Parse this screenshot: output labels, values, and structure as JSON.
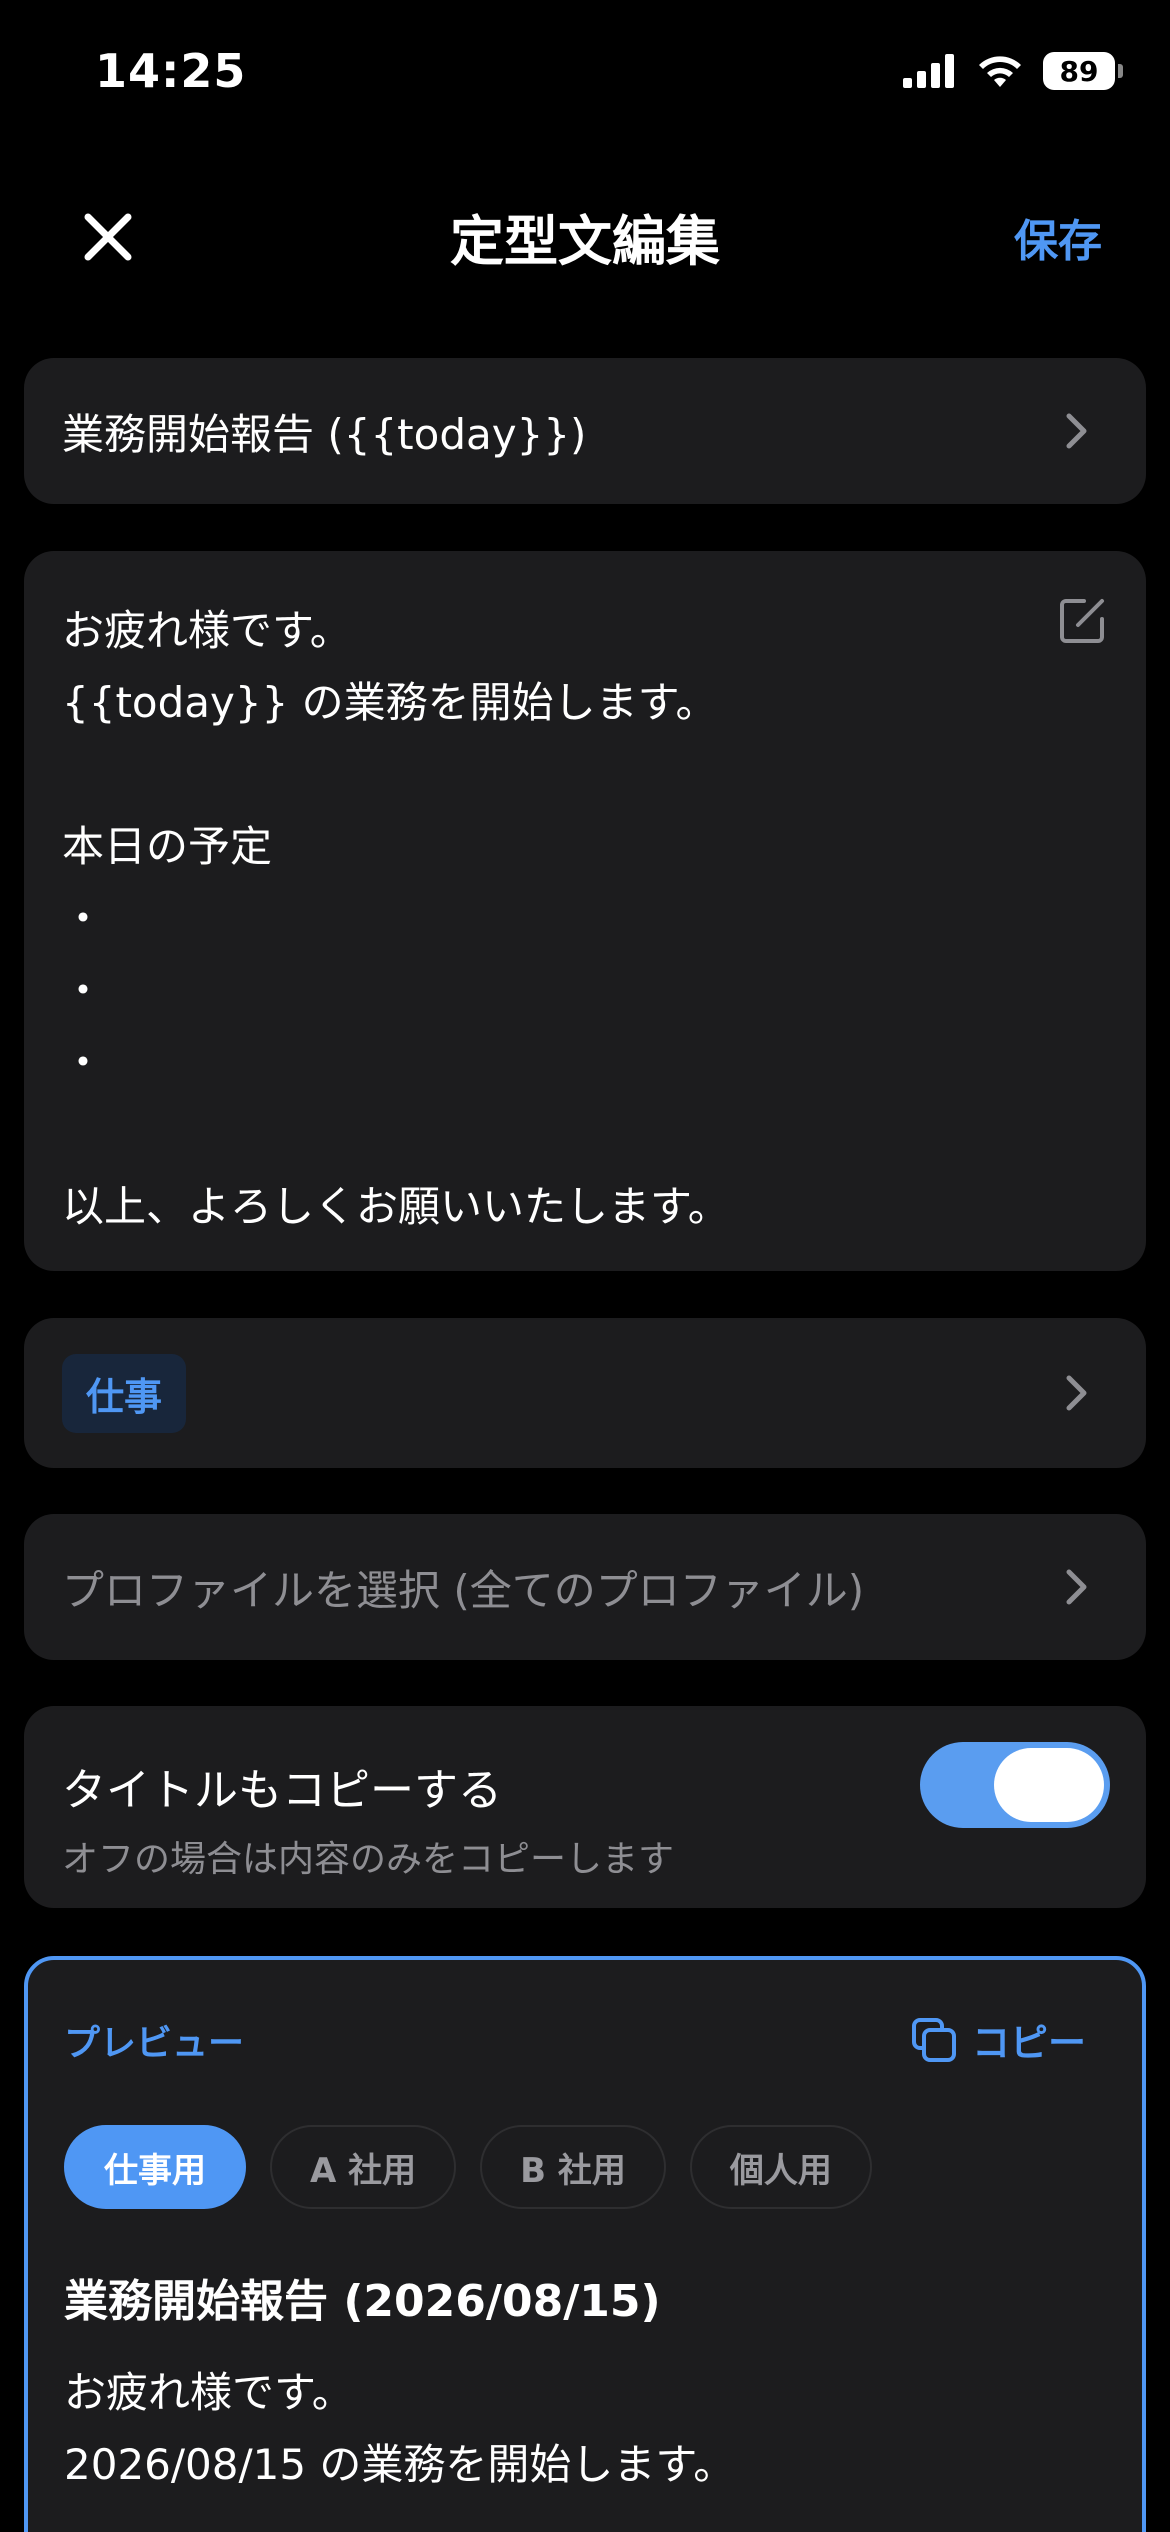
{
  "status": {
    "time": "14:25",
    "battery": "89"
  },
  "nav": {
    "title": "定型文編集",
    "save_label": "保存"
  },
  "template_title": "業務開始報告 ({{today}})",
  "template_body": "お疲れ様です。\n{{today}} の業務を開始します。\n\n本日の予定\n・\n・\n・\n\n以上、よろしくお願いいたします。",
  "category": {
    "tag": "仕事"
  },
  "profile": {
    "placeholder": "プロファイルを選択 (全てのプロファイル)"
  },
  "copy_title": {
    "title": "タイトルもコピーする",
    "subtitle": "オフの場合は内容のみをコピーします",
    "enabled": true
  },
  "preview": {
    "label": "プレビュー",
    "copy_label": "コピー",
    "chips": [
      "仕事用",
      "A 社用",
      "B 社用",
      "個人用"
    ],
    "selected_chip": "仕事用",
    "title": "業務開始報告 (2026/08/15)",
    "body": "お疲れ様です。\n2026/08/15 の業務を開始します。"
  },
  "colors": {
    "accent": "#4f97f4",
    "card": "#1c1c1e",
    "background": "#000000"
  }
}
